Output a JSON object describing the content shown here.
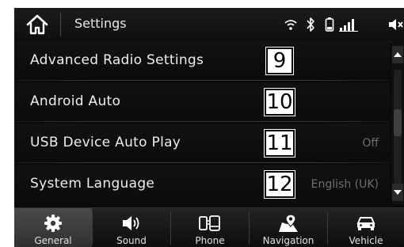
{
  "header": {
    "title": "Settings",
    "home_icon": "home-icon",
    "status_icons": [
      "wifi-icon",
      "bluetooth-icon",
      "battery-icon",
      "signal-icon",
      "volume-icon"
    ]
  },
  "settings": {
    "items": [
      {
        "label": "Advanced Radio Settings",
        "value": "",
        "callout": "9"
      },
      {
        "label": "Android Auto",
        "value": "",
        "callout": "10"
      },
      {
        "label": "USB Device Auto Play",
        "value": "Off",
        "callout": "11"
      },
      {
        "label": "System Language",
        "value": "English (UK)",
        "callout": "12"
      }
    ]
  },
  "scroll": {
    "position": 0.45
  },
  "tabs": [
    {
      "label": "General",
      "icon": "gear-icon",
      "active": true
    },
    {
      "label": "Sound",
      "icon": "speaker-icon",
      "active": false
    },
    {
      "label": "Phone",
      "icon": "phone-icon",
      "active": false
    },
    {
      "label": "Navigation",
      "icon": "navigation-icon",
      "active": false
    },
    {
      "label": "Vehicle",
      "icon": "car-icon",
      "active": false
    }
  ],
  "colors": {
    "background": "#0a0a0a",
    "text": "#ededed",
    "value_text": "#6e6e6e",
    "active_tab": "#404040",
    "callout_bg": "#ffffff"
  }
}
